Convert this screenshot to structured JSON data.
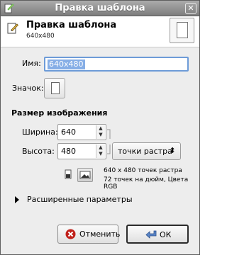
{
  "window": {
    "title": "Правка шаблона",
    "close_glyph": "✕"
  },
  "header": {
    "title": "Правка шаблона",
    "subtitle": "640x480"
  },
  "form": {
    "name_label": "Имя:",
    "name_value": "640x480",
    "icon_label": "Значок:"
  },
  "image_size": {
    "section_title": "Размер изображения",
    "width_label": "Ширина:",
    "width_value": "640",
    "height_label": "Высота:",
    "height_value": "480",
    "unit_value": "точки растра",
    "info_line1": "640 x 480 точек растра",
    "info_line2": "72 точек на дюйм, Цвета RGB"
  },
  "advanced": {
    "label": "Расширенные параметры"
  },
  "buttons": {
    "cancel_label": "Отменить",
    "ok_label": "ОК"
  },
  "colors": {
    "title_bar": "#8f8f8f",
    "selection": "#86aee6",
    "focus_border": "#6d9bd8"
  }
}
